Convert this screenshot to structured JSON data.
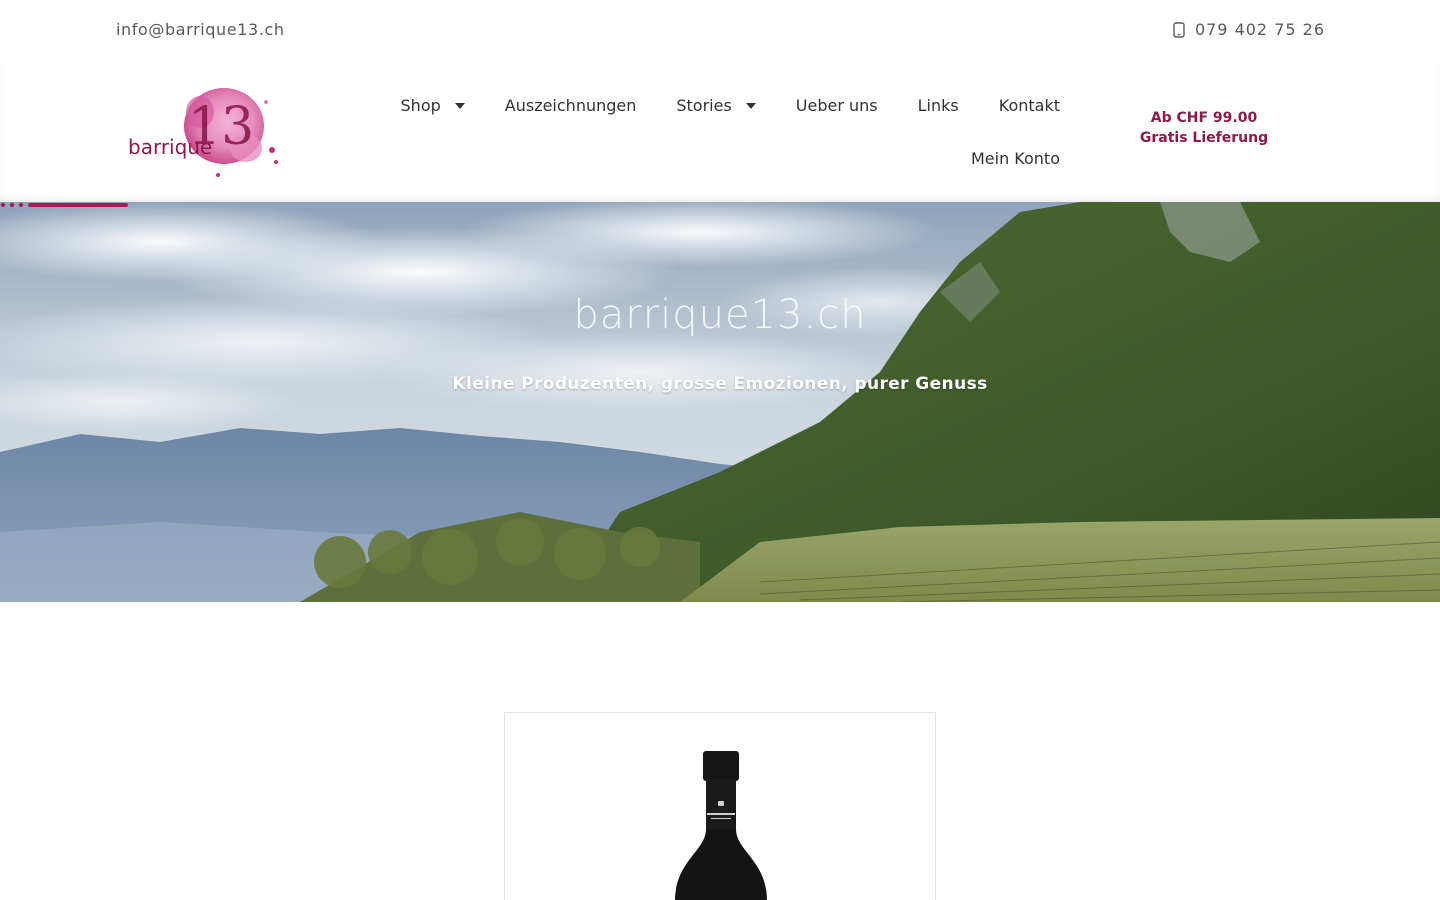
{
  "topbar": {
    "email": "info@barrique13.ch",
    "phone": "079 402 75 26",
    "phone_icon": "phone-icon"
  },
  "logo": {
    "text": "barrique",
    "number": "13",
    "accent_color": "#c2307a"
  },
  "nav": {
    "items": [
      {
        "label": "Shop",
        "has_dropdown": true
      },
      {
        "label": "Auszeichnungen",
        "has_dropdown": false
      },
      {
        "label": "Stories",
        "has_dropdown": true
      },
      {
        "label": "Ueber uns",
        "has_dropdown": false
      },
      {
        "label": "Links",
        "has_dropdown": false
      },
      {
        "label": "Kontakt",
        "has_dropdown": false
      },
      {
        "label": "Mein Konto",
        "has_dropdown": false
      }
    ]
  },
  "promo": {
    "line1": "Ab CHF 99.00",
    "line2": "Gratis Lieferung",
    "color": "#8c1a4b"
  },
  "hero": {
    "title": "barrique13.ch",
    "subtitle": "Kleine Produzenten, grosse Emozionen, purer Genuss",
    "divider_color": "#a01f5a"
  },
  "product_card": {
    "image": "wine-bottle"
  }
}
